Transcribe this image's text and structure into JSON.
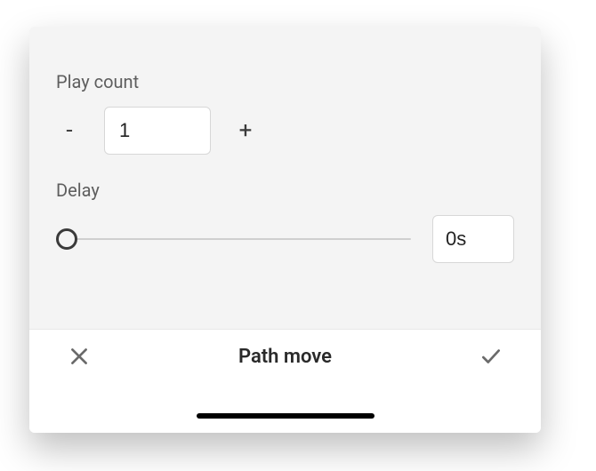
{
  "playCount": {
    "label": "Play count",
    "decrement": "-",
    "increment": "+",
    "value": "1"
  },
  "delay": {
    "label": "Delay",
    "value": "0s",
    "slider_position": 0,
    "slider_min": 0,
    "slider_max": 1
  },
  "footer": {
    "title": "Path move",
    "cancel_icon": "close-icon",
    "confirm_icon": "check-icon"
  }
}
